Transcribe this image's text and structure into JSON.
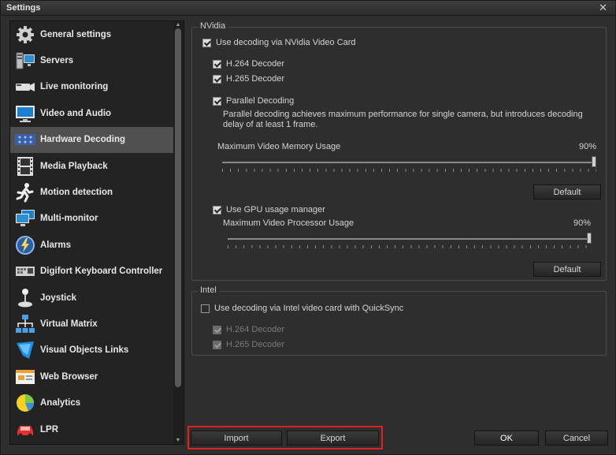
{
  "window": {
    "title": "Settings",
    "close_glyph": "✕"
  },
  "sidebar": {
    "items": [
      {
        "label": "General settings",
        "icon": "gear-icon",
        "active": false
      },
      {
        "label": "Servers",
        "icon": "servers-icon",
        "active": false
      },
      {
        "label": "Live monitoring",
        "icon": "camera-icon",
        "active": false
      },
      {
        "label": "Video and Audio",
        "icon": "monitor-icon",
        "active": false
      },
      {
        "label": "Hardware Decoding",
        "icon": "chip-icon",
        "active": true
      },
      {
        "label": "Media Playback",
        "icon": "film-icon",
        "active": false
      },
      {
        "label": "Motion detection",
        "icon": "running-person-icon",
        "active": false
      },
      {
        "label": "Multi-monitor",
        "icon": "multi-monitor-icon",
        "active": false
      },
      {
        "label": "Alarms",
        "icon": "alarm-bolt-icon",
        "active": false
      },
      {
        "label": "Digifort Keyboard Controller",
        "icon": "keyboard-icon",
        "active": false
      },
      {
        "label": "Joystick",
        "icon": "joystick-icon",
        "active": false
      },
      {
        "label": "Virtual Matrix",
        "icon": "network-icon",
        "active": false
      },
      {
        "label": "Visual Objects Links",
        "icon": "link-shield-icon",
        "active": false
      },
      {
        "label": "Web Browser",
        "icon": "browser-icon",
        "active": false
      },
      {
        "label": "Analytics",
        "icon": "pie-chart-icon",
        "active": false
      },
      {
        "label": "LPR",
        "icon": "car-icon",
        "active": false
      }
    ]
  },
  "nvidia": {
    "legend": "NVidia",
    "use_decoding": {
      "label": "Use decoding via NVidia Video Card",
      "checked": true
    },
    "h264": {
      "label": "H.264 Decoder",
      "checked": true
    },
    "h265": {
      "label": "H.265 Decoder",
      "checked": true
    },
    "parallel": {
      "label": "Parallel Decoding",
      "checked": true
    },
    "parallel_desc": "Parallel decoding achieves maximum performance for single camera, but introduces decoding delay of at least 1 frame.",
    "memory_label": "Maximum Video Memory Usage",
    "memory_value": "90%",
    "memory_percent": 100,
    "default_1": "Default",
    "gpu_manager": {
      "label": "Use GPU usage manager",
      "checked": true
    },
    "processor_label": "Maximum Video Processor Usage",
    "processor_value": "90%",
    "processor_percent": 100,
    "default_2": "Default"
  },
  "intel": {
    "legend": "Intel",
    "use_decoding": {
      "label": "Use decoding via Intel video card with QuickSync",
      "checked": false
    },
    "h264": {
      "label": "H.264 Decoder",
      "checked": true,
      "disabled": true
    },
    "h265": {
      "label": "H.265 Decoder",
      "checked": true,
      "disabled": true
    }
  },
  "footer": {
    "import": "Import",
    "export": "Export",
    "ok": "OK",
    "cancel": "Cancel"
  },
  "colors": {
    "highlight": "#e0201e",
    "active_item": "#505050"
  }
}
